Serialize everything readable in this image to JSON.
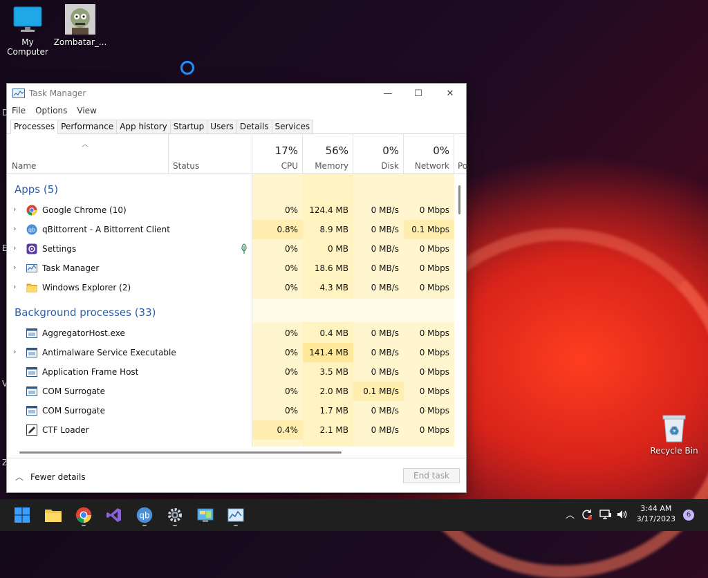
{
  "desktop": {
    "icons": [
      {
        "label": "My Computer"
      },
      {
        "label": "Zombatar_..."
      },
      {
        "label": "Recycle Bin"
      }
    ],
    "edge_letters": [
      "D",
      "E",
      "V",
      "Z"
    ]
  },
  "window": {
    "title": "Task Manager",
    "controls": {
      "minimize": "—",
      "maximize": "☐",
      "close": "✕"
    },
    "menu": [
      "File",
      "Options",
      "View"
    ],
    "tabs": [
      "Processes",
      "Performance",
      "App history",
      "Startup",
      "Users",
      "Details",
      "Services"
    ],
    "active_tab": "Processes",
    "columns": {
      "name": "Name",
      "status": "Status",
      "cpu": {
        "pct": "17%",
        "label": "CPU"
      },
      "memory": {
        "pct": "56%",
        "label": "Memory"
      },
      "disk": {
        "pct": "0%",
        "label": "Disk"
      },
      "network": {
        "pct": "0%",
        "label": "Network"
      },
      "power": "Po"
    },
    "groups": {
      "apps": "Apps (5)",
      "background": "Background processes (33)"
    },
    "apps": [
      {
        "name": "Google Chrome (10)",
        "cpu": "0%",
        "memory": "124.4 MB",
        "disk": "0 MB/s",
        "network": "0 Mbps",
        "icon": "chrome-icon"
      },
      {
        "name": "qBittorrent - A Bittorrent Client",
        "cpu": "0.8%",
        "memory": "8.9 MB",
        "disk": "0 MB/s",
        "network": "0.1 Mbps",
        "icon": "qbittorrent-icon"
      },
      {
        "name": "Settings",
        "cpu": "0%",
        "memory": "0 MB",
        "disk": "0 MB/s",
        "network": "0 Mbps",
        "icon": "settings-icon"
      },
      {
        "name": "Task Manager",
        "cpu": "0%",
        "memory": "18.6 MB",
        "disk": "0 MB/s",
        "network": "0 Mbps",
        "icon": "task-manager-icon"
      },
      {
        "name": "Windows Explorer (2)",
        "cpu": "0%",
        "memory": "4.3 MB",
        "disk": "0 MB/s",
        "network": "0 Mbps",
        "icon": "folder-icon"
      }
    ],
    "background": [
      {
        "name": "AggregatorHost.exe",
        "cpu": "0%",
        "memory": "0.4 MB",
        "disk": "0 MB/s",
        "network": "0 Mbps"
      },
      {
        "name": "Antimalware Service Executable",
        "cpu": "0%",
        "memory": "141.4 MB",
        "disk": "0 MB/s",
        "network": "0 Mbps"
      },
      {
        "name": "Application Frame Host",
        "cpu": "0%",
        "memory": "3.5 MB",
        "disk": "0 MB/s",
        "network": "0 Mbps"
      },
      {
        "name": "COM Surrogate",
        "cpu": "0%",
        "memory": "2.0 MB",
        "disk": "0.1 MB/s",
        "network": "0 Mbps"
      },
      {
        "name": "COM Surrogate",
        "cpu": "0%",
        "memory": "1.7 MB",
        "disk": "0 MB/s",
        "network": "0 Mbps"
      },
      {
        "name": "CTF Loader",
        "cpu": "0.4%",
        "memory": "2.1 MB",
        "disk": "0 MB/s",
        "network": "0 Mbps"
      }
    ],
    "footer": {
      "fewer_details": "Fewer details",
      "end_task": "End task"
    }
  },
  "taskbar": {
    "time": "3:44 AM",
    "date": "3/17/2023",
    "notifications": "6"
  },
  "colors": {
    "heat_light": "#fff9e0",
    "heat_medium": "#fff4c4",
    "heat_strong": "#ffeaa0",
    "group_blue": "#2b5fa8"
  }
}
